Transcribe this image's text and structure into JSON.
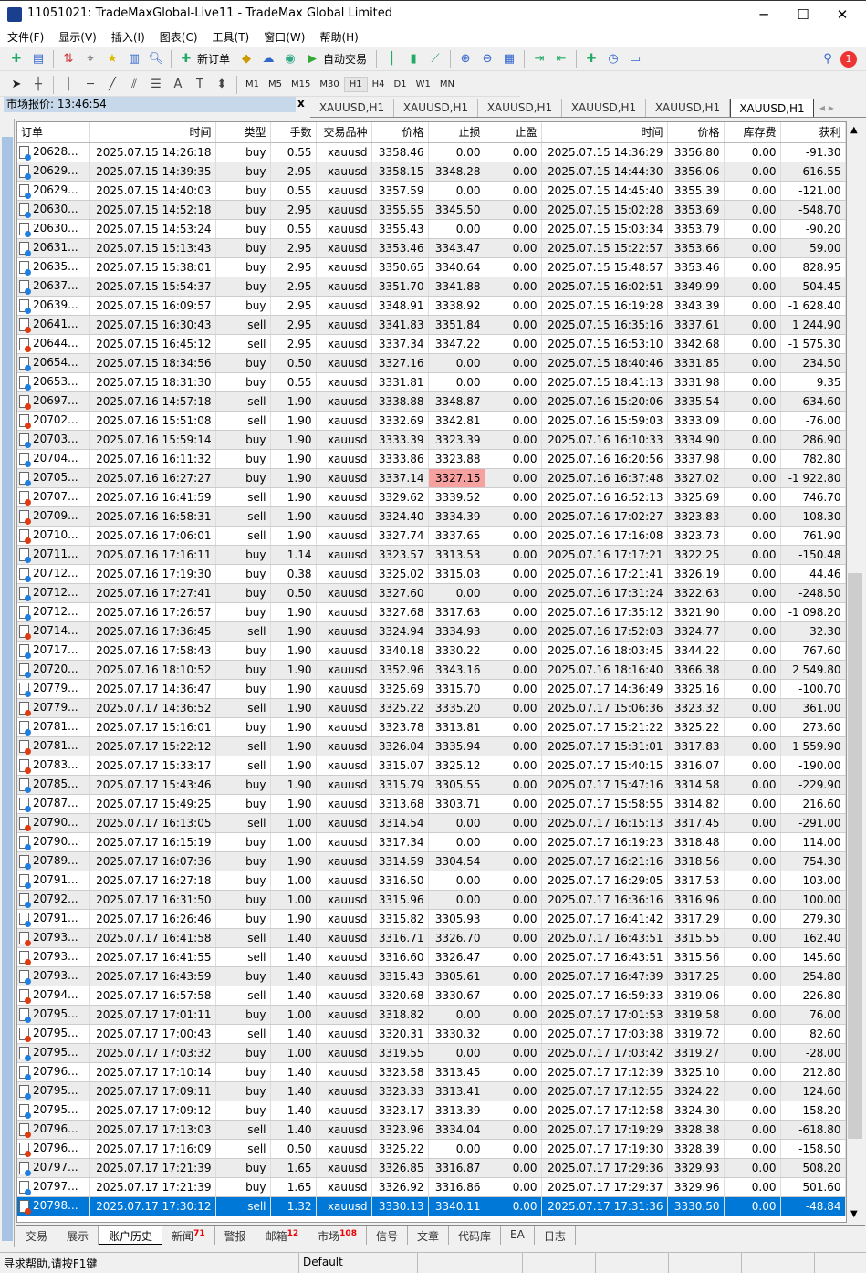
{
  "window": {
    "title": "11051021: TradeMaxGlobal-Live11 - TradeMax Global Limited",
    "minimize": "─",
    "maximize": "☐",
    "close": "✕"
  },
  "menu": [
    "文件(F)",
    "显示(V)",
    "插入(I)",
    "图表(C)",
    "工具(T)",
    "窗口(W)",
    "帮助(H)"
  ],
  "toolbar": {
    "new_order": "新订单",
    "auto_trade": "自动交易",
    "notification_count": "1"
  },
  "timeframes": [
    "M1",
    "M5",
    "M15",
    "M30",
    "H1",
    "H4",
    "D1",
    "W1",
    "MN"
  ],
  "active_timeframe": "H1",
  "market_watch": {
    "label": "市场报价: 13:46:54",
    "close": "x"
  },
  "chart_tabs": [
    "XAUUSD,H1",
    "XAUUSD,H1",
    "XAUUSD,H1",
    "XAUUSD,H1",
    "XAUUSD,H1",
    "XAUUSD,H1"
  ],
  "columns": [
    "订单",
    "时间",
    "类型",
    "手数",
    "交易品种",
    "价格",
    "止损",
    "止盈",
    "时间",
    "价格",
    "库存费",
    "获利"
  ],
  "colors": {
    "buy": "#1e7fe0",
    "sell": "#e03a10",
    "selected": "#0078d7",
    "sl_hit": "#f7a0a0"
  },
  "rows": [
    [
      "20628...",
      "2025.07.15 14:26:18",
      "buy",
      "0.55",
      "xauusd",
      "3358.46",
      "0.00",
      "0.00",
      "2025.07.15 14:36:29",
      "3356.80",
      "0.00",
      "-91.30"
    ],
    [
      "20629...",
      "2025.07.15 14:39:35",
      "buy",
      "2.95",
      "xauusd",
      "3358.15",
      "3348.28",
      "0.00",
      "2025.07.15 14:44:30",
      "3356.06",
      "0.00",
      "-616.55"
    ],
    [
      "20629...",
      "2025.07.15 14:40:03",
      "buy",
      "0.55",
      "xauusd",
      "3357.59",
      "0.00",
      "0.00",
      "2025.07.15 14:45:40",
      "3355.39",
      "0.00",
      "-121.00"
    ],
    [
      "20630...",
      "2025.07.15 14:52:18",
      "buy",
      "2.95",
      "xauusd",
      "3355.55",
      "3345.50",
      "0.00",
      "2025.07.15 15:02:28",
      "3353.69",
      "0.00",
      "-548.70"
    ],
    [
      "20630...",
      "2025.07.15 14:53:24",
      "buy",
      "0.55",
      "xauusd",
      "3355.43",
      "0.00",
      "0.00",
      "2025.07.15 15:03:34",
      "3353.79",
      "0.00",
      "-90.20"
    ],
    [
      "20631...",
      "2025.07.15 15:13:43",
      "buy",
      "2.95",
      "xauusd",
      "3353.46",
      "3343.47",
      "0.00",
      "2025.07.15 15:22:57",
      "3353.66",
      "0.00",
      "59.00"
    ],
    [
      "20635...",
      "2025.07.15 15:38:01",
      "buy",
      "2.95",
      "xauusd",
      "3350.65",
      "3340.64",
      "0.00",
      "2025.07.15 15:48:57",
      "3353.46",
      "0.00",
      "828.95"
    ],
    [
      "20637...",
      "2025.07.15 15:54:37",
      "buy",
      "2.95",
      "xauusd",
      "3351.70",
      "3341.88",
      "0.00",
      "2025.07.15 16:02:51",
      "3349.99",
      "0.00",
      "-504.45"
    ],
    [
      "20639...",
      "2025.07.15 16:09:57",
      "buy",
      "2.95",
      "xauusd",
      "3348.91",
      "3338.92",
      "0.00",
      "2025.07.15 16:19:28",
      "3343.39",
      "0.00",
      "-1 628.40"
    ],
    [
      "20641...",
      "2025.07.15 16:30:43",
      "sell",
      "2.95",
      "xauusd",
      "3341.83",
      "3351.84",
      "0.00",
      "2025.07.15 16:35:16",
      "3337.61",
      "0.00",
      "1 244.90"
    ],
    [
      "20644...",
      "2025.07.15 16:45:12",
      "sell",
      "2.95",
      "xauusd",
      "3337.34",
      "3347.22",
      "0.00",
      "2025.07.15 16:53:10",
      "3342.68",
      "0.00",
      "-1 575.30"
    ],
    [
      "20654...",
      "2025.07.15 18:34:56",
      "buy",
      "0.50",
      "xauusd",
      "3327.16",
      "0.00",
      "0.00",
      "2025.07.15 18:40:46",
      "3331.85",
      "0.00",
      "234.50"
    ],
    [
      "20653...",
      "2025.07.15 18:31:30",
      "buy",
      "0.55",
      "xauusd",
      "3331.81",
      "0.00",
      "0.00",
      "2025.07.15 18:41:13",
      "3331.98",
      "0.00",
      "9.35"
    ],
    [
      "20697...",
      "2025.07.16 14:57:18",
      "sell",
      "1.90",
      "xauusd",
      "3338.88",
      "3348.87",
      "0.00",
      "2025.07.16 15:20:06",
      "3335.54",
      "0.00",
      "634.60"
    ],
    [
      "20702...",
      "2025.07.16 15:51:08",
      "sell",
      "1.90",
      "xauusd",
      "3332.69",
      "3342.81",
      "0.00",
      "2025.07.16 15:59:03",
      "3333.09",
      "0.00",
      "-76.00"
    ],
    [
      "20703...",
      "2025.07.16 15:59:14",
      "buy",
      "1.90",
      "xauusd",
      "3333.39",
      "3323.39",
      "0.00",
      "2025.07.16 16:10:33",
      "3334.90",
      "0.00",
      "286.90"
    ],
    [
      "20704...",
      "2025.07.16 16:11:32",
      "buy",
      "1.90",
      "xauusd",
      "3333.86",
      "3323.88",
      "0.00",
      "2025.07.16 16:20:56",
      "3337.98",
      "0.00",
      "782.80"
    ],
    [
      "20705...",
      "2025.07.16 16:27:27",
      "buy",
      "1.90",
      "xauusd",
      "3337.14",
      "3327.15",
      "0.00",
      "2025.07.16 16:37:48",
      "3327.02",
      "0.00",
      "-1 922.80"
    ],
    [
      "20707...",
      "2025.07.16 16:41:59",
      "sell",
      "1.90",
      "xauusd",
      "3329.62",
      "3339.52",
      "0.00",
      "2025.07.16 16:52:13",
      "3325.69",
      "0.00",
      "746.70"
    ],
    [
      "20709...",
      "2025.07.16 16:58:31",
      "sell",
      "1.90",
      "xauusd",
      "3324.40",
      "3334.39",
      "0.00",
      "2025.07.16 17:02:27",
      "3323.83",
      "0.00",
      "108.30"
    ],
    [
      "20710...",
      "2025.07.16 17:06:01",
      "sell",
      "1.90",
      "xauusd",
      "3327.74",
      "3337.65",
      "0.00",
      "2025.07.16 17:16:08",
      "3323.73",
      "0.00",
      "761.90"
    ],
    [
      "20711...",
      "2025.07.16 17:16:11",
      "buy",
      "1.14",
      "xauusd",
      "3323.57",
      "3313.53",
      "0.00",
      "2025.07.16 17:17:21",
      "3322.25",
      "0.00",
      "-150.48"
    ],
    [
      "20712...",
      "2025.07.16 17:19:30",
      "buy",
      "0.38",
      "xauusd",
      "3325.02",
      "3315.03",
      "0.00",
      "2025.07.16 17:21:41",
      "3326.19",
      "0.00",
      "44.46"
    ],
    [
      "20712...",
      "2025.07.16 17:27:41",
      "buy",
      "0.50",
      "xauusd",
      "3327.60",
      "0.00",
      "0.00",
      "2025.07.16 17:31:24",
      "3322.63",
      "0.00",
      "-248.50"
    ],
    [
      "20712...",
      "2025.07.16 17:26:57",
      "buy",
      "1.90",
      "xauusd",
      "3327.68",
      "3317.63",
      "0.00",
      "2025.07.16 17:35:12",
      "3321.90",
      "0.00",
      "-1 098.20"
    ],
    [
      "20714...",
      "2025.07.16 17:36:45",
      "sell",
      "1.90",
      "xauusd",
      "3324.94",
      "3334.93",
      "0.00",
      "2025.07.16 17:52:03",
      "3324.77",
      "0.00",
      "32.30"
    ],
    [
      "20717...",
      "2025.07.16 17:58:43",
      "buy",
      "1.90",
      "xauusd",
      "3340.18",
      "3330.22",
      "0.00",
      "2025.07.16 18:03:45",
      "3344.22",
      "0.00",
      "767.60"
    ],
    [
      "20720...",
      "2025.07.16 18:10:52",
      "buy",
      "1.90",
      "xauusd",
      "3352.96",
      "3343.16",
      "0.00",
      "2025.07.16 18:16:40",
      "3366.38",
      "0.00",
      "2 549.80"
    ],
    [
      "20779...",
      "2025.07.17 14:36:47",
      "buy",
      "1.90",
      "xauusd",
      "3325.69",
      "3315.70",
      "0.00",
      "2025.07.17 14:36:49",
      "3325.16",
      "0.00",
      "-100.70"
    ],
    [
      "20779...",
      "2025.07.17 14:36:52",
      "sell",
      "1.90",
      "xauusd",
      "3325.22",
      "3335.20",
      "0.00",
      "2025.07.17 15:06:36",
      "3323.32",
      "0.00",
      "361.00"
    ],
    [
      "20781...",
      "2025.07.17 15:16:01",
      "buy",
      "1.90",
      "xauusd",
      "3323.78",
      "3313.81",
      "0.00",
      "2025.07.17 15:21:22",
      "3325.22",
      "0.00",
      "273.60"
    ],
    [
      "20781...",
      "2025.07.17 15:22:12",
      "sell",
      "1.90",
      "xauusd",
      "3326.04",
      "3335.94",
      "0.00",
      "2025.07.17 15:31:01",
      "3317.83",
      "0.00",
      "1 559.90"
    ],
    [
      "20783...",
      "2025.07.17 15:33:17",
      "sell",
      "1.90",
      "xauusd",
      "3315.07",
      "3325.12",
      "0.00",
      "2025.07.17 15:40:15",
      "3316.07",
      "0.00",
      "-190.00"
    ],
    [
      "20785...",
      "2025.07.17 15:43:46",
      "buy",
      "1.90",
      "xauusd",
      "3315.79",
      "3305.55",
      "0.00",
      "2025.07.17 15:47:16",
      "3314.58",
      "0.00",
      "-229.90"
    ],
    [
      "20787...",
      "2025.07.17 15:49:25",
      "buy",
      "1.90",
      "xauusd",
      "3313.68",
      "3303.71",
      "0.00",
      "2025.07.17 15:58:55",
      "3314.82",
      "0.00",
      "216.60"
    ],
    [
      "20790...",
      "2025.07.17 16:13:05",
      "sell",
      "1.00",
      "xauusd",
      "3314.54",
      "0.00",
      "0.00",
      "2025.07.17 16:15:13",
      "3317.45",
      "0.00",
      "-291.00"
    ],
    [
      "20790...",
      "2025.07.17 16:15:19",
      "buy",
      "1.00",
      "xauusd",
      "3317.34",
      "0.00",
      "0.00",
      "2025.07.17 16:19:23",
      "3318.48",
      "0.00",
      "114.00"
    ],
    [
      "20789...",
      "2025.07.17 16:07:36",
      "buy",
      "1.90",
      "xauusd",
      "3314.59",
      "3304.54",
      "0.00",
      "2025.07.17 16:21:16",
      "3318.56",
      "0.00",
      "754.30"
    ],
    [
      "20791...",
      "2025.07.17 16:27:18",
      "buy",
      "1.00",
      "xauusd",
      "3316.50",
      "0.00",
      "0.00",
      "2025.07.17 16:29:05",
      "3317.53",
      "0.00",
      "103.00"
    ],
    [
      "20792...",
      "2025.07.17 16:31:50",
      "buy",
      "1.00",
      "xauusd",
      "3315.96",
      "0.00",
      "0.00",
      "2025.07.17 16:36:16",
      "3316.96",
      "0.00",
      "100.00"
    ],
    [
      "20791...",
      "2025.07.17 16:26:46",
      "buy",
      "1.90",
      "xauusd",
      "3315.82",
      "3305.93",
      "0.00",
      "2025.07.17 16:41:42",
      "3317.29",
      "0.00",
      "279.30"
    ],
    [
      "20793...",
      "2025.07.17 16:41:58",
      "sell",
      "1.40",
      "xauusd",
      "3316.71",
      "3326.70",
      "0.00",
      "2025.07.17 16:43:51",
      "3315.55",
      "0.00",
      "162.40"
    ],
    [
      "20793...",
      "2025.07.17 16:41:55",
      "sell",
      "1.40",
      "xauusd",
      "3316.60",
      "3326.47",
      "0.00",
      "2025.07.17 16:43:51",
      "3315.56",
      "0.00",
      "145.60"
    ],
    [
      "20793...",
      "2025.07.17 16:43:59",
      "buy",
      "1.40",
      "xauusd",
      "3315.43",
      "3305.61",
      "0.00",
      "2025.07.17 16:47:39",
      "3317.25",
      "0.00",
      "254.80"
    ],
    [
      "20794...",
      "2025.07.17 16:57:58",
      "sell",
      "1.40",
      "xauusd",
      "3320.68",
      "3330.67",
      "0.00",
      "2025.07.17 16:59:33",
      "3319.06",
      "0.00",
      "226.80"
    ],
    [
      "20795...",
      "2025.07.17 17:01:11",
      "buy",
      "1.00",
      "xauusd",
      "3318.82",
      "0.00",
      "0.00",
      "2025.07.17 17:01:53",
      "3319.58",
      "0.00",
      "76.00"
    ],
    [
      "20795...",
      "2025.07.17 17:00:43",
      "sell",
      "1.40",
      "xauusd",
      "3320.31",
      "3330.32",
      "0.00",
      "2025.07.17 17:03:38",
      "3319.72",
      "0.00",
      "82.60"
    ],
    [
      "20795...",
      "2025.07.17 17:03:32",
      "buy",
      "1.00",
      "xauusd",
      "3319.55",
      "0.00",
      "0.00",
      "2025.07.17 17:03:42",
      "3319.27",
      "0.00",
      "-28.00"
    ],
    [
      "20796...",
      "2025.07.17 17:10:14",
      "buy",
      "1.40",
      "xauusd",
      "3323.58",
      "3313.45",
      "0.00",
      "2025.07.17 17:12:39",
      "3325.10",
      "0.00",
      "212.80"
    ],
    [
      "20795...",
      "2025.07.17 17:09:11",
      "buy",
      "1.40",
      "xauusd",
      "3323.33",
      "3313.41",
      "0.00",
      "2025.07.17 17:12:55",
      "3324.22",
      "0.00",
      "124.60"
    ],
    [
      "20795...",
      "2025.07.17 17:09:12",
      "buy",
      "1.40",
      "xauusd",
      "3323.17",
      "3313.39",
      "0.00",
      "2025.07.17 17:12:58",
      "3324.30",
      "0.00",
      "158.20"
    ],
    [
      "20796...",
      "2025.07.17 17:13:03",
      "sell",
      "1.40",
      "xauusd",
      "3323.96",
      "3334.04",
      "0.00",
      "2025.07.17 17:19:29",
      "3328.38",
      "0.00",
      "-618.80"
    ],
    [
      "20796...",
      "2025.07.17 17:16:09",
      "sell",
      "0.50",
      "xauusd",
      "3325.22",
      "0.00",
      "0.00",
      "2025.07.17 17:19:30",
      "3328.39",
      "0.00",
      "-158.50"
    ],
    [
      "20797...",
      "2025.07.17 17:21:39",
      "buy",
      "1.65",
      "xauusd",
      "3326.85",
      "3316.87",
      "0.00",
      "2025.07.17 17:29:36",
      "3329.93",
      "0.00",
      "508.20"
    ],
    [
      "20797...",
      "2025.07.17 17:21:39",
      "buy",
      "1.65",
      "xauusd",
      "3326.92",
      "3316.86",
      "0.00",
      "2025.07.17 17:29:37",
      "3329.96",
      "0.00",
      "501.60"
    ],
    [
      "20798...",
      "2025.07.17 17:30:12",
      "sell",
      "1.32",
      "xauusd",
      "3330.13",
      "3340.11",
      "0.00",
      "2025.07.17 17:31:36",
      "3330.50",
      "0.00",
      "-48.84"
    ]
  ],
  "selected_row": 55,
  "sl_hit_row": 17,
  "bottom_tabs": [
    {
      "label": "交易"
    },
    {
      "label": "展示"
    },
    {
      "label": "账户历史"
    },
    {
      "label": "新闻",
      "badge": "71"
    },
    {
      "label": "警报"
    },
    {
      "label": "邮箱",
      "badge": "12"
    },
    {
      "label": "市场",
      "badge": "108"
    },
    {
      "label": "信号"
    },
    {
      "label": "文章"
    },
    {
      "label": "代码库"
    },
    {
      "label": "EA"
    },
    {
      "label": "日志"
    }
  ],
  "active_bottom_tab": 2,
  "status": {
    "help": "寻求帮助,请按F1键",
    "profile": "Default"
  }
}
